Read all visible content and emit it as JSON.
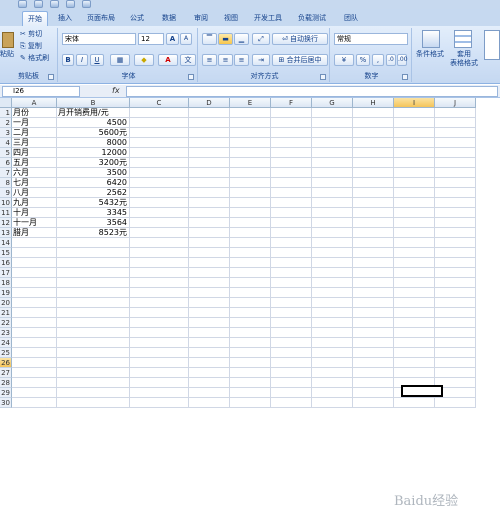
{
  "tabs": [
    "开始",
    "插入",
    "页面布局",
    "公式",
    "数据",
    "审阅",
    "视图",
    "开发工具",
    "负载测试",
    "团队"
  ],
  "clipboard": {
    "paste": "粘贴",
    "cut": "剪切",
    "copy": "复制",
    "format_painter": "格式刷",
    "label": "剪贴板"
  },
  "font": {
    "name": "宋体",
    "size": "12",
    "grow": "A",
    "shrink": "A",
    "bold": "B",
    "italic": "I",
    "underline": "U",
    "label": "字体"
  },
  "alignment": {
    "wrap_text": "自动换行",
    "merge_center": "合并后居中",
    "label": "对齐方式"
  },
  "number": {
    "format": "常规",
    "percent": "%",
    "comma": ",",
    "label": "数字"
  },
  "styles": {
    "conditional": "条件格式",
    "table": "套用\n表格格式"
  },
  "formula_bar": {
    "cell_ref": "I26",
    "fx": "fx",
    "value": ""
  },
  "columns": [
    "A",
    "B",
    "C",
    "D",
    "E",
    "F",
    "G",
    "H",
    "I",
    "J"
  ],
  "rows": [
    "1",
    "2",
    "3",
    "4",
    "5",
    "6",
    "7",
    "8",
    "9",
    "10",
    "11",
    "12",
    "13",
    "14",
    "15",
    "16",
    "17",
    "18",
    "19",
    "20",
    "21",
    "22",
    "23",
    "24",
    "25",
    "26",
    "27",
    "28",
    "29",
    "30"
  ],
  "sheet": {
    "header": {
      "a": "月份",
      "b": "月开销费用/元"
    },
    "data": [
      {
        "a": "一月",
        "b": "4500"
      },
      {
        "a": "二月",
        "b": "5600元"
      },
      {
        "a": "三月",
        "b": "8000"
      },
      {
        "a": "四月",
        "b": "12000"
      },
      {
        "a": "五月",
        "b": "3200元"
      },
      {
        "a": "六月",
        "b": "3500"
      },
      {
        "a": "七月",
        "b": "6420"
      },
      {
        "a": "八月",
        "b": "2562"
      },
      {
        "a": "九月",
        "b": "5432元"
      },
      {
        "a": "十月",
        "b": "3345"
      },
      {
        "a": "十一月",
        "b": "3564"
      },
      {
        "a": "腊月",
        "b": "8523元"
      }
    ]
  },
  "selected_cell": "I26",
  "watermark": "Baidu经验"
}
